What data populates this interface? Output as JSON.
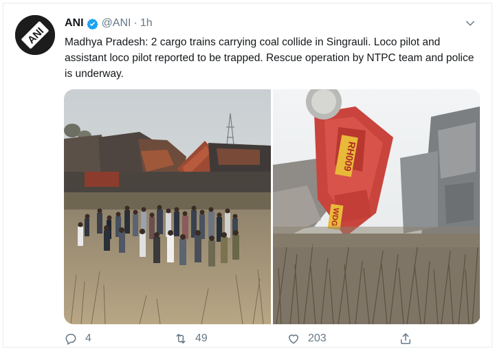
{
  "tweet": {
    "display_name": "ANI",
    "handle": "@ANI",
    "separator": "·",
    "time": "1h",
    "verified": true,
    "avatar_logo_text": "ANI",
    "text": "Madhya Pradesh: 2 cargo trains carrying coal collide in Singrauli. Loco pilot and assistant loco pilot reported to be trapped. Rescue operation by NTPC team and police is underway.",
    "media": [
      {
        "description_icon": "photo-crowd-at-derailed-cargo-train"
      },
      {
        "description_icon": "photo-overturned-red-locomotive"
      }
    ],
    "locomotive_markings": [
      "RH009",
      "WDG"
    ],
    "actions": {
      "reply_count": "4",
      "retweet_count": "49",
      "like_count": "203"
    }
  },
  "colors": {
    "text": "#14171a",
    "secondary": "#657786",
    "verified": "#1da1f2",
    "border": "#e6ecf0"
  }
}
